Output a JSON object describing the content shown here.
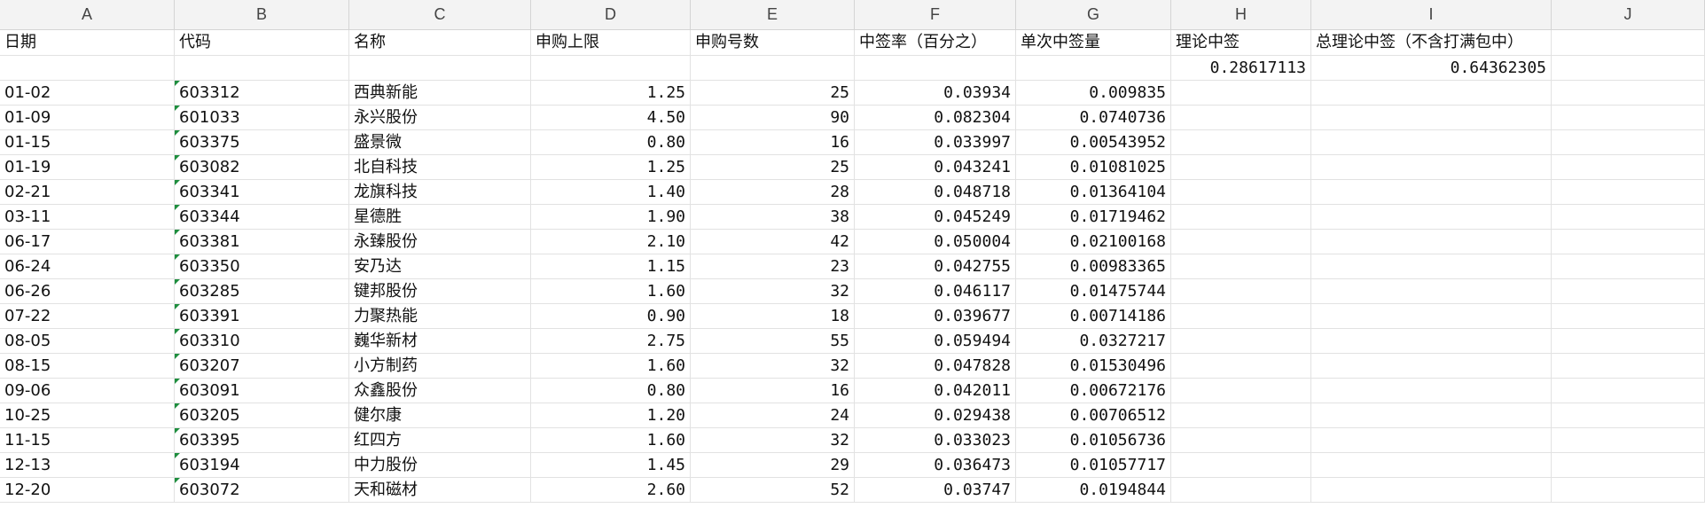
{
  "columns": [
    "A",
    "B",
    "C",
    "D",
    "E",
    "F",
    "G",
    "H",
    "I",
    "J"
  ],
  "header": [
    "日期",
    "代码",
    "名称",
    "申购上限",
    "申购号数",
    "中签率（百分之）",
    "单次中签量",
    "理论中签",
    "总理论中签（不含打满包中）"
  ],
  "summary": {
    "H": "0.28617113",
    "I": "0.64362305"
  },
  "rows": [
    {
      "date": "01-02",
      "code": "603312",
      "name": "西典新能",
      "limit": "1.25",
      "count": "25",
      "rate": "0.03934",
      "single": "0.009835"
    },
    {
      "date": "01-09",
      "code": "601033",
      "name": "永兴股份",
      "limit": "4.50",
      "count": "90",
      "rate": "0.082304",
      "single": "0.0740736"
    },
    {
      "date": "01-15",
      "code": "603375",
      "name": "盛景微",
      "limit": "0.80",
      "count": "16",
      "rate": "0.033997",
      "single": "0.00543952"
    },
    {
      "date": "01-19",
      "code": "603082",
      "name": "北自科技",
      "limit": "1.25",
      "count": "25",
      "rate": "0.043241",
      "single": "0.01081025"
    },
    {
      "date": "02-21",
      "code": "603341",
      "name": "龙旗科技",
      "limit": "1.40",
      "count": "28",
      "rate": "0.048718",
      "single": "0.01364104"
    },
    {
      "date": "03-11",
      "code": "603344",
      "name": "星德胜",
      "limit": "1.90",
      "count": "38",
      "rate": "0.045249",
      "single": "0.01719462"
    },
    {
      "date": "06-17",
      "code": "603381",
      "name": "永臻股份",
      "limit": "2.10",
      "count": "42",
      "rate": "0.050004",
      "single": "0.02100168"
    },
    {
      "date": "06-24",
      "code": "603350",
      "name": "安乃达",
      "limit": "1.15",
      "count": "23",
      "rate": "0.042755",
      "single": "0.00983365"
    },
    {
      "date": "06-26",
      "code": "603285",
      "name": "键邦股份",
      "limit": "1.60",
      "count": "32",
      "rate": "0.046117",
      "single": "0.01475744"
    },
    {
      "date": "07-22",
      "code": "603391",
      "name": "力聚热能",
      "limit": "0.90",
      "count": "18",
      "rate": "0.039677",
      "single": "0.00714186"
    },
    {
      "date": "08-05",
      "code": "603310",
      "name": "巍华新材",
      "limit": "2.75",
      "count": "55",
      "rate": "0.059494",
      "single": "0.0327217"
    },
    {
      "date": "08-15",
      "code": "603207",
      "name": "小方制药",
      "limit": "1.60",
      "count": "32",
      "rate": "0.047828",
      "single": "0.01530496"
    },
    {
      "date": "09-06",
      "code": "603091",
      "name": "众鑫股份",
      "limit": "0.80",
      "count": "16",
      "rate": "0.042011",
      "single": "0.00672176"
    },
    {
      "date": "10-25",
      "code": "603205",
      "name": "健尔康",
      "limit": "1.20",
      "count": "24",
      "rate": "0.029438",
      "single": "0.00706512"
    },
    {
      "date": "11-15",
      "code": "603395",
      "name": "红四方",
      "limit": "1.60",
      "count": "32",
      "rate": "0.033023",
      "single": "0.01056736"
    },
    {
      "date": "12-13",
      "code": "603194",
      "name": "中力股份",
      "limit": "1.45",
      "count": "29",
      "rate": "0.036473",
      "single": "0.01057717"
    },
    {
      "date": "12-20",
      "code": "603072",
      "name": "天和磁材",
      "limit": "2.60",
      "count": "52",
      "rate": "0.03747",
      "single": "0.0194844"
    }
  ],
  "colors": {
    "header_bg": "#f3f3f3",
    "grid": "#e2e2e2",
    "flag": "#1e8e3e"
  }
}
